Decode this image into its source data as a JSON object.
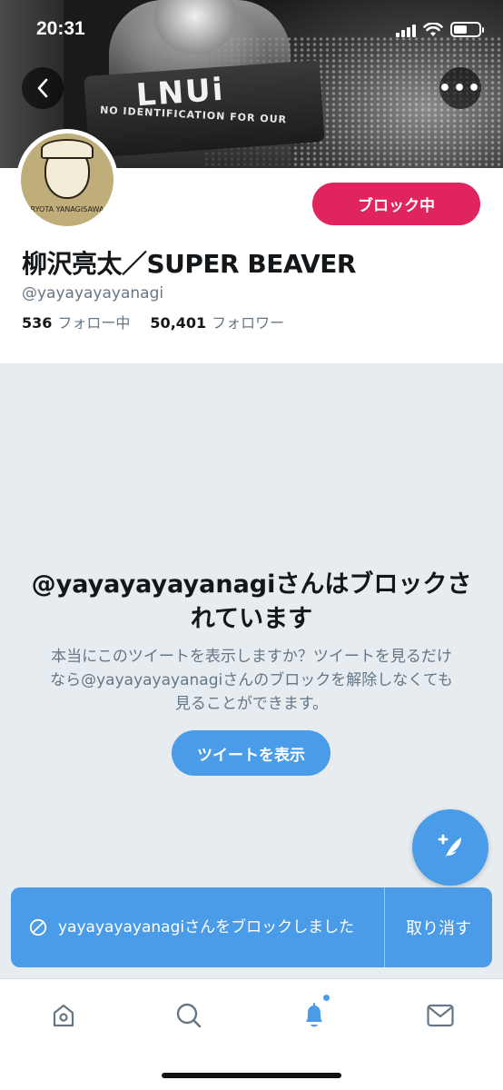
{
  "status_bar": {
    "time": "20:31",
    "battery_level": 0.55
  },
  "header": {
    "back_icon": "chevron-left-icon",
    "more_icon": "ellipsis-icon",
    "more_label": "•••",
    "banner_text_main": "LNUi",
    "banner_text_sub": "NO IDENTIFICATION FOR OUR"
  },
  "profile": {
    "avatar_text": "RYOTA YANAGISAWA",
    "block_button_label": "ブロック中",
    "display_name": "柳沢亮太／SUPER BEAVER",
    "handle": "@yayayayayanagi",
    "following_count": "536",
    "following_label": "フォロー中",
    "followers_count": "50,401",
    "followers_label": "フォロワー"
  },
  "blocked": {
    "title": "@yayayayayanagiさんはブロックされています",
    "description": "本当にこのツイートを表示しますか？ツイートを見るだけなら@yayayayayanagiさんのブロックを解除しなくても見ることができます。",
    "view_button_label": "ツイートを表示"
  },
  "fab": {
    "icon": "compose-tweet-icon",
    "label": "+"
  },
  "toast": {
    "icon": "blocked-icon",
    "message": "yayayayayanagiさんをブロックしました",
    "undo_label": "取り消す"
  },
  "tabbar": {
    "items": [
      {
        "icon": "home-icon"
      },
      {
        "icon": "search-icon"
      },
      {
        "icon": "notifications-icon",
        "has_badge": true
      },
      {
        "icon": "messages-icon"
      }
    ]
  },
  "colors": {
    "accent": "#4a9be8",
    "block_red": "#e0245e",
    "background": "#e6ecf0",
    "secondary_text": "#657786"
  }
}
